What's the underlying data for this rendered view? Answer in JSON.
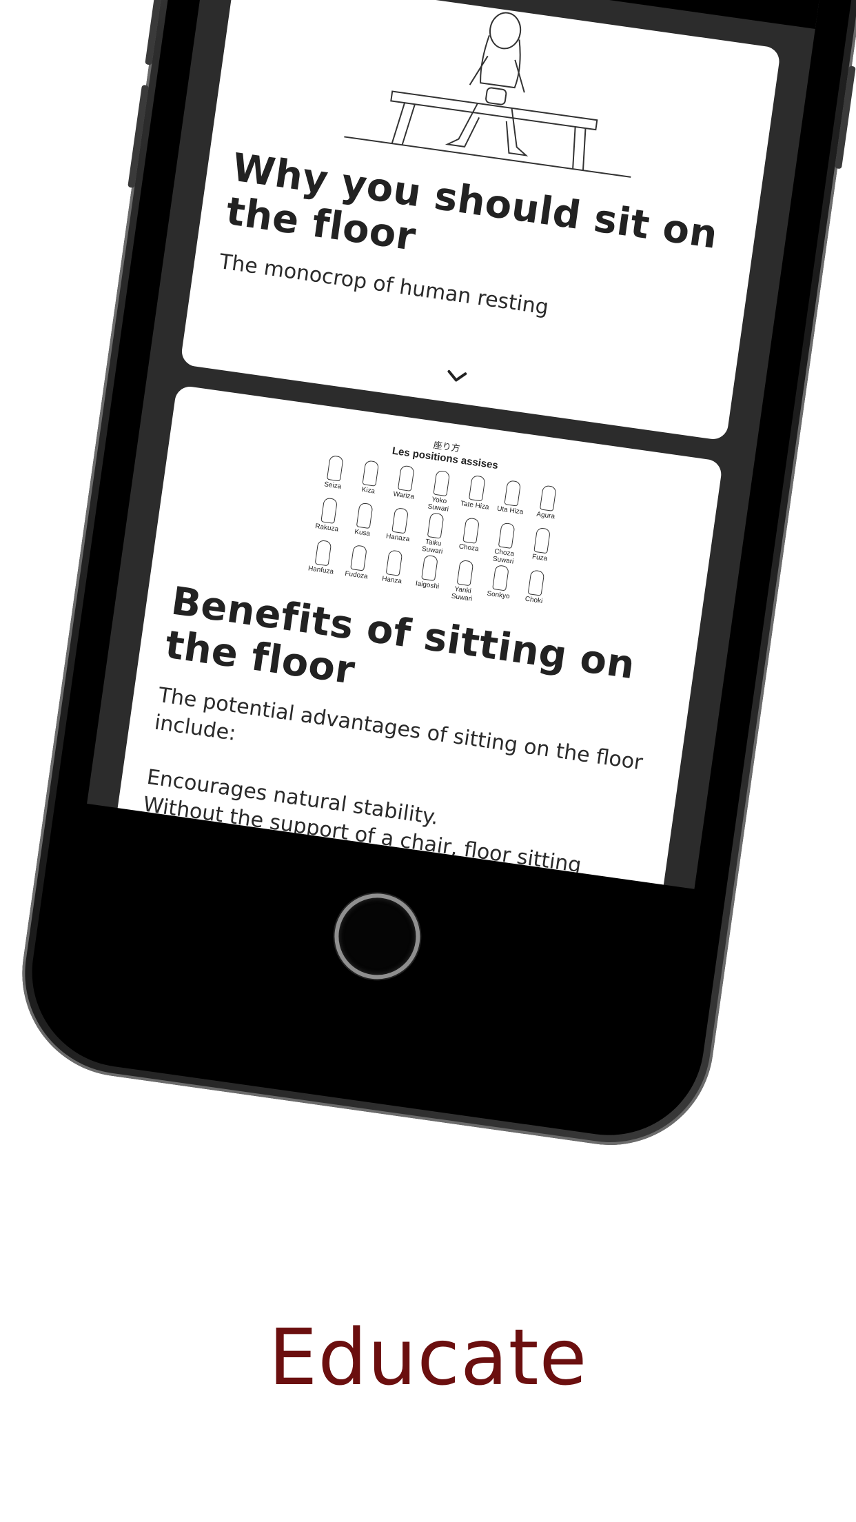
{
  "header": {
    "back_label": ""
  },
  "cards": [
    {
      "title": "Why you should sit on the floor",
      "subtitle": "The monocrop of human resting"
    },
    {
      "chart_header_jp": "座り方",
      "chart_header": "Les positions assises",
      "postures": [
        "Seiza",
        "Kiza",
        "Wariza",
        "Yoko Suwari",
        "Tate Hiza",
        "Uta Hiza",
        "Agura",
        "Rakuza",
        "Kusa",
        "Hanaza",
        "Taiku Suwari",
        "Choza",
        "Choza Suwari",
        "Fuza",
        "Hanfuza",
        "Fudoza",
        "Hanza",
        "Iaigoshi",
        "Yanki Suwari",
        "Sonkyo",
        "Choki"
      ],
      "title": "Benefits of sitting on the floor",
      "subtitle": "The potential advantages of sitting on the floor include:",
      "body": "Encourages natural stability.\nWithout the support of a chair, floor sitting forces"
    }
  ],
  "caption": "Educate",
  "colors": {
    "caption": "#6b0f0f",
    "screen_bg": "#2c2c2c"
  }
}
